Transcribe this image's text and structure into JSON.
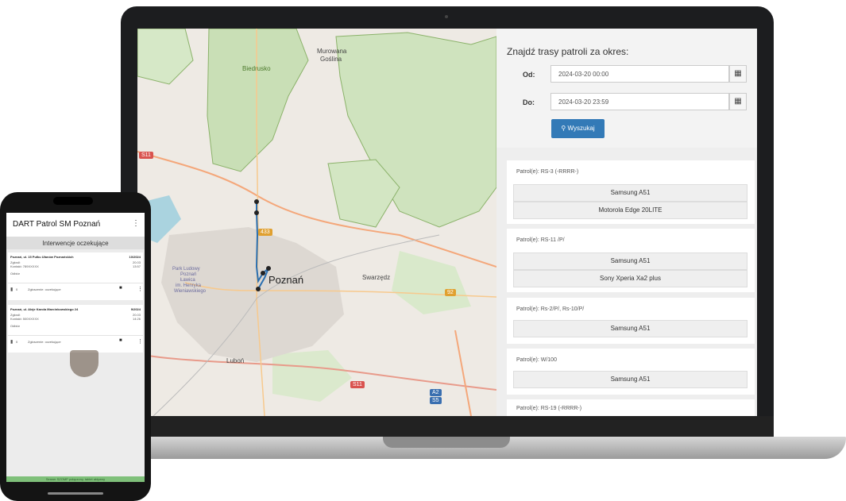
{
  "map": {
    "labels": {
      "murowana": "Murowana",
      "goslina": "Goślina",
      "biedrusko": "Biedrusko",
      "poznan": "Poznań",
      "swarzedz": "Swarzędz",
      "lubon": "Luboń",
      "park1": "Park Ludowy",
      "park2": "Poznań",
      "park3": "Ławica",
      "park4": "im. Henryka",
      "park5": "Wieniawskiego"
    },
    "shields": {
      "s11_top": "S11",
      "r92": "92",
      "s11_bottom": "S11",
      "a2": "A2",
      "s5": "S5",
      "r433": "433"
    }
  },
  "search": {
    "title": "Znajdź trasy patroli za okres:",
    "from_label": "Od:",
    "from_value": "2024-03-20 00:00",
    "to_label": "Do:",
    "to_value": "2024-03-20 23:59",
    "button": "Wyszukaj",
    "calendar_icon": "calendar-icon",
    "search_icon": "search-icon"
  },
  "patrols": [
    {
      "label": "Patrol(e): RS-3 (-RRRR-)",
      "devices": [
        "Samsung A51",
        "Motorola Edge 20LITE"
      ]
    },
    {
      "label": "Patrol(e): RS-11 /P/",
      "devices": [
        "Samsung A51",
        "Sony Xperia Xa2 plus"
      ]
    },
    {
      "label": "Patrol(e): Rs-2/P/, Rs-10/P/",
      "devices": [
        "Samsung A51"
      ]
    },
    {
      "label": "Patrol(e): W/100",
      "devices": [
        "Samsung A51"
      ]
    },
    {
      "label": "Patrol(e): RS-19 (-RRRR-)",
      "devices": []
    }
  ],
  "phone": {
    "app_title": "DART Patrol SM Poznań",
    "menu_icon": "more-vert-icon",
    "header": "Interwencje oczekujące",
    "interventions": [
      {
        "address": "Poznań, ul. 15 Pułku Ułanów Poznańskich",
        "number": "10/2024",
        "line1": "Zgłosił:",
        "line2": "Kontakt: 789XXXXX",
        "type": "Odbiór",
        "date": "20.03",
        "time": "13:57",
        "note": "Zgłoszenie: oczekujące",
        "count": "0"
      },
      {
        "address": "Poznań, ul. Aleje Karola Marcinkowskiego 24",
        "number": "9/2024",
        "line1": "Zgłosił:",
        "line2": "Kontakt: 500XXXXX",
        "type": "Odbiór",
        "date": "20.03",
        "time": "14:26",
        "note": "Zgłoszenie: oczekujące",
        "count": "0"
      }
    ],
    "footer": "Serwer SZOMP połączony, tablet aktywny"
  },
  "colors": {
    "primary": "#337ab7",
    "route": "#2a6fb0",
    "forest": "#c9dfb6",
    "status_ok": "#7fc07a"
  }
}
